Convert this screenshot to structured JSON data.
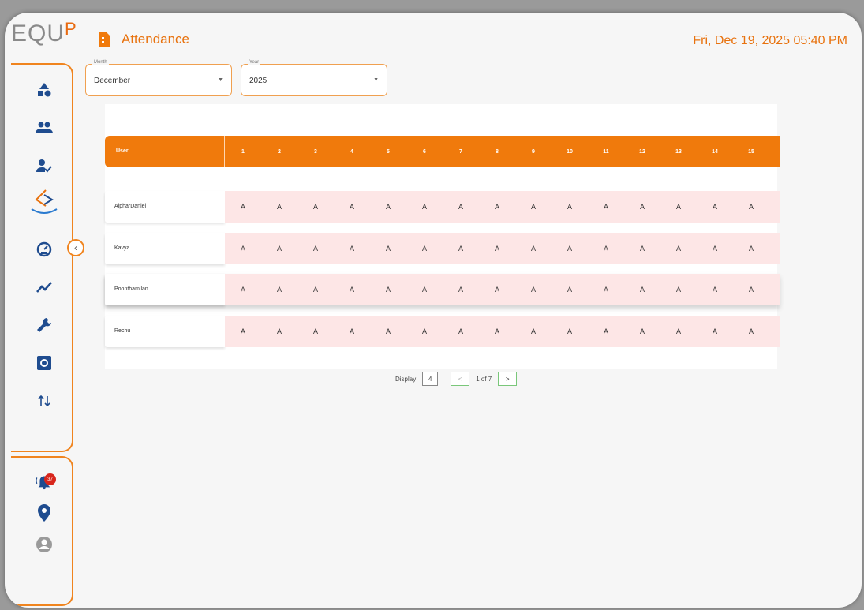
{
  "app": {
    "logo_text": "EQU",
    "logo_accent": "P"
  },
  "header": {
    "title": "Attendance",
    "datetime": "Fri, Dec 19, 2025 05:40 PM"
  },
  "filters": {
    "month": {
      "label": "Month",
      "value": "December"
    },
    "year": {
      "label": "Year",
      "value": "2025"
    }
  },
  "table": {
    "user_header": "User",
    "days": [
      "1",
      "2",
      "3",
      "4",
      "5",
      "6",
      "7",
      "8",
      "9",
      "10",
      "11",
      "12",
      "13",
      "14",
      "15"
    ],
    "rows": [
      {
        "name": "AlpharDaniel",
        "marks": [
          "A",
          "A",
          "A",
          "A",
          "A",
          "A",
          "A",
          "A",
          "A",
          "A",
          "A",
          "A",
          "A",
          "A",
          "A"
        ]
      },
      {
        "name": "Kavya",
        "marks": [
          "A",
          "A",
          "A",
          "A",
          "A",
          "A",
          "A",
          "A",
          "A",
          "A",
          "A",
          "A",
          "A",
          "A",
          "A"
        ]
      },
      {
        "name": "Poonthamilan",
        "marks": [
          "A",
          "A",
          "A",
          "A",
          "A",
          "A",
          "A",
          "A",
          "A",
          "A",
          "A",
          "A",
          "A",
          "A",
          "A"
        ]
      },
      {
        "name": "Rechu",
        "marks": [
          "A",
          "A",
          "A",
          "A",
          "A",
          "A",
          "A",
          "A",
          "A",
          "A",
          "A",
          "A",
          "A",
          "A",
          "A"
        ]
      }
    ]
  },
  "pagination": {
    "display_label": "Display",
    "page_size": "4",
    "prev": "<",
    "page_info": "1 of 7",
    "next": ">"
  },
  "notifications": {
    "count": "37"
  },
  "icons": [
    "shapes-icon",
    "group-icon",
    "user-check-icon",
    "brand-logo-icon",
    "gauge-icon",
    "trend-icon",
    "wrench-icon",
    "settings-icon",
    "sort-icon",
    "bell-icon",
    "location-icon",
    "avatar-icon"
  ],
  "colors": {
    "accent": "#f07a0c",
    "absent_bg": "#fde6e6",
    "badge": "#d8261c"
  }
}
